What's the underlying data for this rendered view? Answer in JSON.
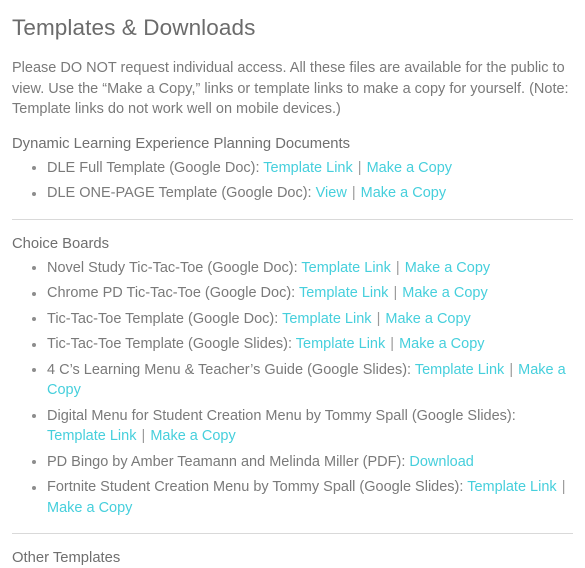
{
  "page": {
    "title": "Templates & Downloads",
    "intro": "Please DO NOT request individual access. All these files are available for the public to view. Use the “Make a Copy,” links or template links to make a copy for yourself. (Note: Template links do not work well on mobile devices.)"
  },
  "colors": {
    "link": "#46cfdc",
    "text": "#7a7a7a",
    "heading": "#6b6b6b",
    "divider": "#d9d9d9",
    "bullet": "#8d8d8d"
  },
  "separator": "|",
  "sections": [
    {
      "heading": "Dynamic Learning Experience Planning Documents",
      "items": [
        {
          "label": "DLE Full Template (Google Doc):",
          "links": [
            "Template Link",
            "Make a Copy"
          ]
        },
        {
          "label": "DLE ONE-PAGE Template (Google Doc):",
          "links": [
            "View",
            "Make a Copy"
          ]
        }
      ]
    },
    {
      "heading": "Choice Boards",
      "items": [
        {
          "label": "Novel Study Tic-Tac-Toe (Google Doc):",
          "links": [
            "Template Link",
            "Make a Copy"
          ]
        },
        {
          "label": "Chrome PD Tic-Tac-Toe (Google Doc):",
          "links": [
            "Template Link",
            "Make a Copy"
          ]
        },
        {
          "label": "Tic-Tac-Toe Template (Google Doc):",
          "links": [
            "Template Link",
            "Make a Copy"
          ]
        },
        {
          "label": "Tic-Tac-Toe Template (Google Slides):",
          "links": [
            "Template Link",
            "Make a Copy"
          ]
        },
        {
          "label": "4 C’s Learning Menu & Teacher’s Guide (Google Slides):",
          "links": [
            "Template Link",
            "Make a Copy"
          ]
        },
        {
          "label": "Digital Menu for Student Creation Menu by Tommy Spall (Google Slides):",
          "links": [
            "Template Link",
            "Make a Copy"
          ]
        },
        {
          "label": "PD Bingo by Amber Teamann and Melinda Miller (PDF):",
          "links": [
            "Download"
          ]
        },
        {
          "label": "Fortnite Student Creation Menu by Tommy Spall (Google Slides):",
          "links": [
            "Template Link",
            "Make a Copy"
          ]
        }
      ]
    },
    {
      "heading": "Other Templates",
      "items": []
    }
  ]
}
